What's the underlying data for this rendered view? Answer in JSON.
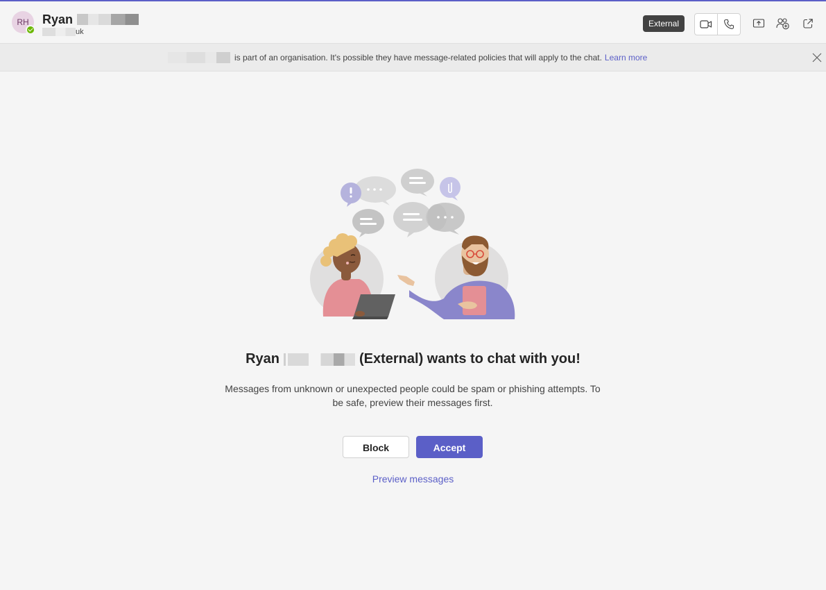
{
  "header": {
    "avatar_initials": "RH",
    "presence": "available",
    "name_first": "Ryan",
    "email_suffix": "uk",
    "external_badge": "External",
    "icons": [
      "video-call-icon",
      "audio-call-icon",
      "share-screen-icon",
      "add-people-icon",
      "pop-out-icon"
    ]
  },
  "banner": {
    "text": "is part of an organisation. It's possible they have message-related policies that will apply to the chat.",
    "link": "Learn more"
  },
  "main": {
    "headline_name": "Ryan",
    "headline_rest": "(External) wants to chat with you!",
    "description": "Messages from unknown or unexpected people could be spam or phishing attempts. To be safe, preview their messages first.",
    "block_label": "Block",
    "accept_label": "Accept",
    "preview_label": "Preview messages"
  },
  "colors": {
    "accent": "#5b5fc7",
    "presence": "#6bb700",
    "badge": "#424242"
  }
}
